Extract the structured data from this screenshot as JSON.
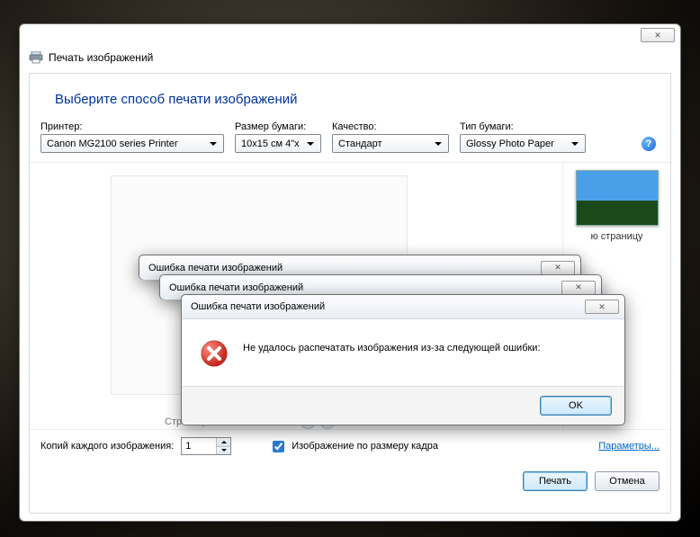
{
  "app_title": "Печать изображений",
  "heading": "Выберите способ печати изображений",
  "options": {
    "printer_label": "Принтер:",
    "printer_value": "Canon MG2100 series Printer",
    "paper_size_label": "Размер бумаги:",
    "paper_size_value": "10x15 см 4\"x",
    "quality_label": "Качество:",
    "quality_value": "Стандарт",
    "paper_type_label": "Тип бумаги:",
    "paper_type_value": "Glossy Photo Paper"
  },
  "preview": {
    "page_counter": "Страница 1 из 1"
  },
  "side": {
    "thumb_label": "ю страницу"
  },
  "footer": {
    "copies_label": "Копий каждого изображения:",
    "copies_value": "1",
    "fit_checkbox_checked": true,
    "fit_label": "Изображение по размеру кадра",
    "params_link": "Параметры..."
  },
  "buttons": {
    "print": "Печать",
    "cancel": "Отмена"
  },
  "error": {
    "title": "Ошибка печати изображений",
    "message": "Не удалось распечатать изображения из-за следующей ошибки:",
    "ok": "OK"
  }
}
